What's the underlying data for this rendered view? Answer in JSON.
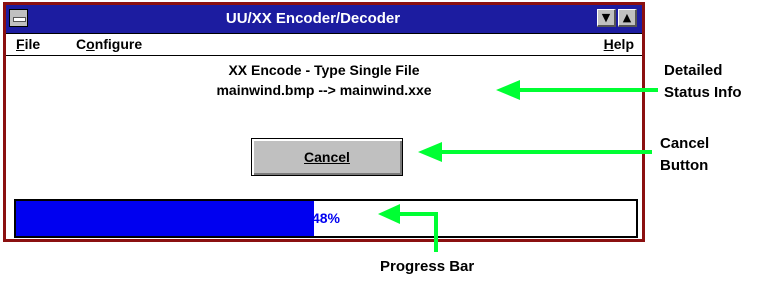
{
  "window": {
    "title": "UU/XX Encoder/Decoder",
    "minimize_glyph": "▼",
    "maximize_glyph": "▲"
  },
  "menu": {
    "file": {
      "hotkey": "F",
      "rest": "ile"
    },
    "configure": {
      "pre": "C",
      "hotkey": "o",
      "rest": "nfigure"
    },
    "help": {
      "hotkey": "H",
      "rest": "elp"
    }
  },
  "status": {
    "line1": "XX Encode - Type Single File",
    "line2": "mainwind.bmp --> mainwind.xxe"
  },
  "cancel_button": {
    "label": "Cancel"
  },
  "progress": {
    "percent": 48,
    "label": "48%"
  },
  "annotations": {
    "status_info": [
      "Detailed",
      "Status Info"
    ],
    "cancel_button": [
      "Cancel",
      "Button"
    ],
    "progress_bar": "Progress Bar"
  },
  "colors": {
    "titlebar": "#1c1ca0",
    "window_border": "#8b1010",
    "progress_fill": "#0000f0",
    "arrow": "#00ff33"
  }
}
